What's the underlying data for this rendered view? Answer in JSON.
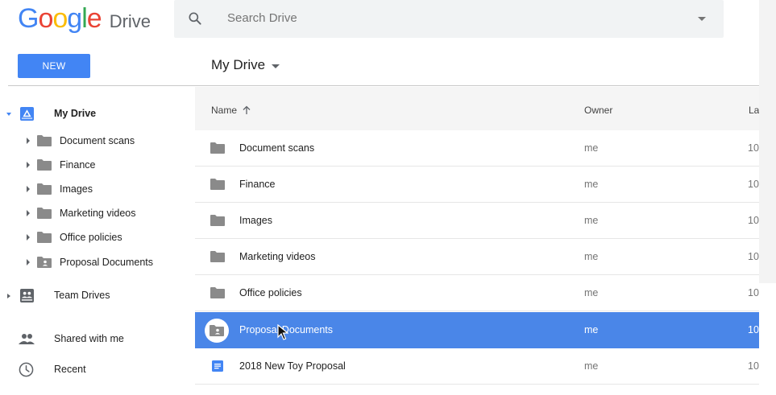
{
  "header": {
    "logo_letters": [
      "G",
      "o",
      "o",
      "g",
      "l",
      "e"
    ],
    "logo_colors": [
      "#4285f4",
      "#ea4335",
      "#fbbc05",
      "#4285f4",
      "#34a853",
      "#ea4335"
    ],
    "product_name": "Drive",
    "search_placeholder": "Search Drive",
    "search_icon": "search-icon",
    "dropdown_icon": "caret-down-icon"
  },
  "toolbar": {
    "new_label": "NEW",
    "location_title": "My Drive",
    "accent_color": "#4285f4"
  },
  "sidebar": {
    "my_drive_label": "My Drive",
    "folders": [
      {
        "label": "Document scans",
        "icon": "folder-icon"
      },
      {
        "label": "Finance",
        "icon": "folder-icon"
      },
      {
        "label": "Images",
        "icon": "folder-icon"
      },
      {
        "label": "Marketing videos",
        "icon": "folder-icon"
      },
      {
        "label": "Office policies",
        "icon": "folder-icon"
      },
      {
        "label": "Proposal Documents",
        "icon": "shared-folder-icon"
      }
    ],
    "team_drives_label": "Team Drives",
    "shared_label": "Shared with me",
    "recent_label": "Recent"
  },
  "file_list": {
    "columns": {
      "name": "Name",
      "owner": "Owner",
      "last_modified": "La"
    },
    "rows": [
      {
        "name": "Document scans",
        "owner": "me",
        "modified": "10",
        "icon": "folder-icon",
        "selected": false
      },
      {
        "name": "Finance",
        "owner": "me",
        "modified": "10",
        "icon": "folder-icon",
        "selected": false
      },
      {
        "name": "Images",
        "owner": "me",
        "modified": "10",
        "icon": "folder-icon",
        "selected": false
      },
      {
        "name": "Marketing videos",
        "owner": "me",
        "modified": "10",
        "icon": "folder-icon",
        "selected": false
      },
      {
        "name": "Office policies",
        "owner": "me",
        "modified": "10",
        "icon": "folder-icon",
        "selected": false
      },
      {
        "name": "Proposal Documents",
        "owner": "me",
        "modified": "10",
        "icon": "shared-folder-icon",
        "selected": true
      },
      {
        "name": "2018 New Toy Proposal",
        "owner": "me",
        "modified": "10",
        "icon": "google-doc-icon",
        "selected": false
      }
    ],
    "selected_color": "#4a86e8"
  }
}
